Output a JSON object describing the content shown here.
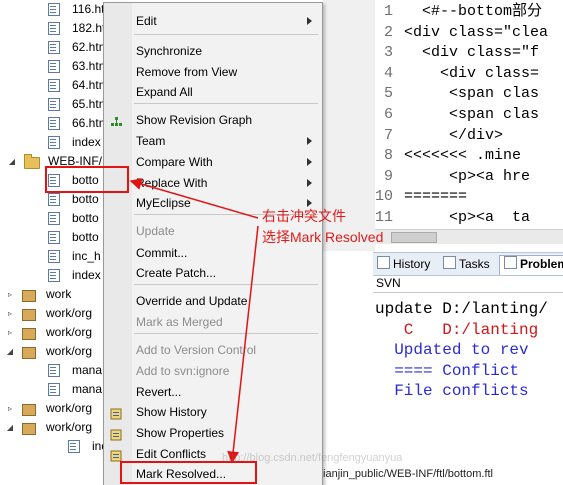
{
  "tree": {
    "rows": [
      {
        "label": "116.ht",
        "icon": "html-file-icon"
      },
      {
        "label": "182.ht",
        "icon": "html-file-icon"
      },
      {
        "label": "62.htm",
        "icon": "html-file-icon"
      },
      {
        "label": "63.htm",
        "icon": "html-file-icon"
      },
      {
        "label": "64.htm",
        "icon": "html-file-icon"
      },
      {
        "label": "65.htm",
        "icon": "html-file-icon"
      },
      {
        "label": "66.htm",
        "icon": "html-file-icon"
      },
      {
        "label": "index",
        "icon": "html-file-icon"
      },
      {
        "label": "WEB-INF/",
        "icon": "folder-icon"
      },
      {
        "label": "botto",
        "icon": "conflict-file-icon"
      },
      {
        "label": "botto",
        "icon": "html-file-icon"
      },
      {
        "label": "botto",
        "icon": "html-file-icon"
      },
      {
        "label": "botto",
        "icon": "html-file-icon"
      },
      {
        "label": "inc_h",
        "icon": "html-file-icon"
      },
      {
        "label": "index",
        "icon": "html-file-icon"
      },
      {
        "label": "work",
        "icon": "package-icon"
      },
      {
        "label": "work/org",
        "icon": "package-icon"
      },
      {
        "label": "work/org",
        "icon": "package-icon"
      },
      {
        "label": "work/org",
        "icon": "package-icon"
      },
      {
        "label": "mana",
        "icon": "java-file-icon"
      },
      {
        "label": "mana",
        "icon": "java-file-icon"
      },
      {
        "label": "work/org",
        "icon": "package-icon"
      },
      {
        "label": "work/org",
        "icon": "package-icon"
      },
      {
        "label": "index",
        "icon": "html-file-icon"
      }
    ]
  },
  "menu": {
    "items": [
      {
        "label": "Edit",
        "submenu": true,
        "disabled": false
      },
      {
        "label": "Synchronize",
        "submenu": false,
        "disabled": false
      },
      {
        "label": "Remove from View",
        "submenu": false,
        "disabled": false
      },
      {
        "label": "Expand All",
        "submenu": false,
        "disabled": false
      },
      {
        "label": "Show Revision Graph",
        "submenu": false,
        "disabled": false
      },
      {
        "label": "Team",
        "submenu": true,
        "disabled": false
      },
      {
        "label": "Compare With",
        "submenu": true,
        "disabled": false
      },
      {
        "label": "Replace With",
        "submenu": true,
        "disabled": false
      },
      {
        "label": "MyEclipse",
        "submenu": true,
        "disabled": false
      },
      {
        "label": "Update",
        "submenu": false,
        "disabled": true
      },
      {
        "label": "Commit...",
        "submenu": false,
        "disabled": false
      },
      {
        "label": "Create Patch...",
        "submenu": false,
        "disabled": false
      },
      {
        "label": "Override and Update",
        "submenu": false,
        "disabled": false
      },
      {
        "label": "Mark as Merged",
        "submenu": false,
        "disabled": true
      },
      {
        "label": "Add to Version Control",
        "submenu": false,
        "disabled": true
      },
      {
        "label": "Add to svn:ignore",
        "submenu": false,
        "disabled": true
      },
      {
        "label": "Revert...",
        "submenu": false,
        "disabled": false
      },
      {
        "label": "Show History",
        "submenu": false,
        "disabled": false
      },
      {
        "label": "Show Properties",
        "submenu": false,
        "disabled": false
      },
      {
        "label": "Edit Conflicts",
        "submenu": false,
        "disabled": false
      },
      {
        "label": "Mark Resolved...",
        "submenu": false,
        "disabled": false
      }
    ]
  },
  "editor": {
    "lines": [
      {
        "num": "1",
        "text": "  <#--bottom部分"
      },
      {
        "num": "2",
        "text": "<div class=\"clea"
      },
      {
        "num": "3",
        "text": "  <div class=\"f"
      },
      {
        "num": "4",
        "text": "    <div class="
      },
      {
        "num": "5",
        "text": "     <span clas"
      },
      {
        "num": "6",
        "text": "     <span clas"
      },
      {
        "num": "7",
        "text": "     </div>"
      },
      {
        "num": "8",
        "text": "<<<<<<< .mine"
      },
      {
        "num": "9",
        "text": "     <p><a hre"
      },
      {
        "num": "10",
        "text": "======="
      },
      {
        "num": "11",
        "text": "     <p><a  ta"
      }
    ]
  },
  "views": {
    "tabs": [
      "History",
      "Tasks",
      "Problem"
    ],
    "svn_label": "SVN",
    "console_lines": [
      "update D:/lanting/",
      "   C   D:/lanting",
      "  Updated to rev",
      "  ==== Conflict",
      "  File conflicts"
    ]
  },
  "status": {
    "path": "tianjin_public/WEB-INF/ftl/bottom.ftl"
  },
  "annotation": {
    "line1": "右击冲突文件",
    "line2": "选择Mark Resolved"
  },
  "watermark": "http://blog.csdn.net/fengfengyuanyua",
  "colors": {
    "annotation_red": "#e31313",
    "console_blue": "#2b2bd6",
    "conflict_red": "#d31616"
  }
}
